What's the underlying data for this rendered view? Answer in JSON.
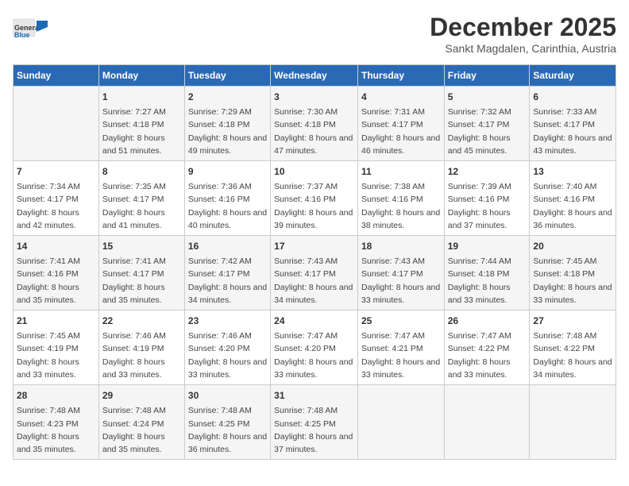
{
  "logo": {
    "general": "General",
    "blue": "Blue"
  },
  "header": {
    "month": "December 2025",
    "location": "Sankt Magdalen, Carinthia, Austria"
  },
  "days_of_week": [
    "Sunday",
    "Monday",
    "Tuesday",
    "Wednesday",
    "Thursday",
    "Friday",
    "Saturday"
  ],
  "weeks": [
    [
      {
        "day": "",
        "sunrise": "",
        "sunset": "",
        "daylight": ""
      },
      {
        "day": "1",
        "sunrise": "Sunrise: 7:27 AM",
        "sunset": "Sunset: 4:18 PM",
        "daylight": "Daylight: 8 hours and 51 minutes."
      },
      {
        "day": "2",
        "sunrise": "Sunrise: 7:29 AM",
        "sunset": "Sunset: 4:18 PM",
        "daylight": "Daylight: 8 hours and 49 minutes."
      },
      {
        "day": "3",
        "sunrise": "Sunrise: 7:30 AM",
        "sunset": "Sunset: 4:18 PM",
        "daylight": "Daylight: 8 hours and 47 minutes."
      },
      {
        "day": "4",
        "sunrise": "Sunrise: 7:31 AM",
        "sunset": "Sunset: 4:17 PM",
        "daylight": "Daylight: 8 hours and 46 minutes."
      },
      {
        "day": "5",
        "sunrise": "Sunrise: 7:32 AM",
        "sunset": "Sunset: 4:17 PM",
        "daylight": "Daylight: 8 hours and 45 minutes."
      },
      {
        "day": "6",
        "sunrise": "Sunrise: 7:33 AM",
        "sunset": "Sunset: 4:17 PM",
        "daylight": "Daylight: 8 hours and 43 minutes."
      }
    ],
    [
      {
        "day": "7",
        "sunrise": "Sunrise: 7:34 AM",
        "sunset": "Sunset: 4:17 PM",
        "daylight": "Daylight: 8 hours and 42 minutes."
      },
      {
        "day": "8",
        "sunrise": "Sunrise: 7:35 AM",
        "sunset": "Sunset: 4:17 PM",
        "daylight": "Daylight: 8 hours and 41 minutes."
      },
      {
        "day": "9",
        "sunrise": "Sunrise: 7:36 AM",
        "sunset": "Sunset: 4:16 PM",
        "daylight": "Daylight: 8 hours and 40 minutes."
      },
      {
        "day": "10",
        "sunrise": "Sunrise: 7:37 AM",
        "sunset": "Sunset: 4:16 PM",
        "daylight": "Daylight: 8 hours and 39 minutes."
      },
      {
        "day": "11",
        "sunrise": "Sunrise: 7:38 AM",
        "sunset": "Sunset: 4:16 PM",
        "daylight": "Daylight: 8 hours and 38 minutes."
      },
      {
        "day": "12",
        "sunrise": "Sunrise: 7:39 AM",
        "sunset": "Sunset: 4:16 PM",
        "daylight": "Daylight: 8 hours and 37 minutes."
      },
      {
        "day": "13",
        "sunrise": "Sunrise: 7:40 AM",
        "sunset": "Sunset: 4:16 PM",
        "daylight": "Daylight: 8 hours and 36 minutes."
      }
    ],
    [
      {
        "day": "14",
        "sunrise": "Sunrise: 7:41 AM",
        "sunset": "Sunset: 4:16 PM",
        "daylight": "Daylight: 8 hours and 35 minutes."
      },
      {
        "day": "15",
        "sunrise": "Sunrise: 7:41 AM",
        "sunset": "Sunset: 4:17 PM",
        "daylight": "Daylight: 8 hours and 35 minutes."
      },
      {
        "day": "16",
        "sunrise": "Sunrise: 7:42 AM",
        "sunset": "Sunset: 4:17 PM",
        "daylight": "Daylight: 8 hours and 34 minutes."
      },
      {
        "day": "17",
        "sunrise": "Sunrise: 7:43 AM",
        "sunset": "Sunset: 4:17 PM",
        "daylight": "Daylight: 8 hours and 34 minutes."
      },
      {
        "day": "18",
        "sunrise": "Sunrise: 7:43 AM",
        "sunset": "Sunset: 4:17 PM",
        "daylight": "Daylight: 8 hours and 33 minutes."
      },
      {
        "day": "19",
        "sunrise": "Sunrise: 7:44 AM",
        "sunset": "Sunset: 4:18 PM",
        "daylight": "Daylight: 8 hours and 33 minutes."
      },
      {
        "day": "20",
        "sunrise": "Sunrise: 7:45 AM",
        "sunset": "Sunset: 4:18 PM",
        "daylight": "Daylight: 8 hours and 33 minutes."
      }
    ],
    [
      {
        "day": "21",
        "sunrise": "Sunrise: 7:45 AM",
        "sunset": "Sunset: 4:19 PM",
        "daylight": "Daylight: 8 hours and 33 minutes."
      },
      {
        "day": "22",
        "sunrise": "Sunrise: 7:46 AM",
        "sunset": "Sunset: 4:19 PM",
        "daylight": "Daylight: 8 hours and 33 minutes."
      },
      {
        "day": "23",
        "sunrise": "Sunrise: 7:46 AM",
        "sunset": "Sunset: 4:20 PM",
        "daylight": "Daylight: 8 hours and 33 minutes."
      },
      {
        "day": "24",
        "sunrise": "Sunrise: 7:47 AM",
        "sunset": "Sunset: 4:20 PM",
        "daylight": "Daylight: 8 hours and 33 minutes."
      },
      {
        "day": "25",
        "sunrise": "Sunrise: 7:47 AM",
        "sunset": "Sunset: 4:21 PM",
        "daylight": "Daylight: 8 hours and 33 minutes."
      },
      {
        "day": "26",
        "sunrise": "Sunrise: 7:47 AM",
        "sunset": "Sunset: 4:22 PM",
        "daylight": "Daylight: 8 hours and 33 minutes."
      },
      {
        "day": "27",
        "sunrise": "Sunrise: 7:48 AM",
        "sunset": "Sunset: 4:22 PM",
        "daylight": "Daylight: 8 hours and 34 minutes."
      }
    ],
    [
      {
        "day": "28",
        "sunrise": "Sunrise: 7:48 AM",
        "sunset": "Sunset: 4:23 PM",
        "daylight": "Daylight: 8 hours and 35 minutes."
      },
      {
        "day": "29",
        "sunrise": "Sunrise: 7:48 AM",
        "sunset": "Sunset: 4:24 PM",
        "daylight": "Daylight: 8 hours and 35 minutes."
      },
      {
        "day": "30",
        "sunrise": "Sunrise: 7:48 AM",
        "sunset": "Sunset: 4:25 PM",
        "daylight": "Daylight: 8 hours and 36 minutes."
      },
      {
        "day": "31",
        "sunrise": "Sunrise: 7:48 AM",
        "sunset": "Sunset: 4:25 PM",
        "daylight": "Daylight: 8 hours and 37 minutes."
      },
      {
        "day": "",
        "sunrise": "",
        "sunset": "",
        "daylight": ""
      },
      {
        "day": "",
        "sunrise": "",
        "sunset": "",
        "daylight": ""
      },
      {
        "day": "",
        "sunrise": "",
        "sunset": "",
        "daylight": ""
      }
    ]
  ]
}
